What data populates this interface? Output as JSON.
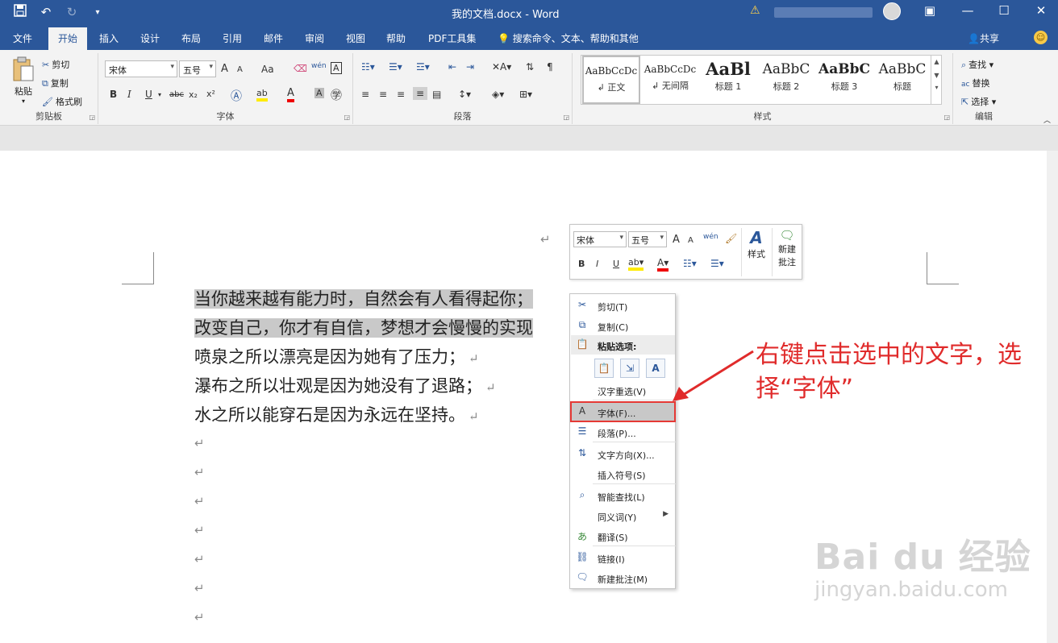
{
  "window": {
    "title": "我的文档.docx  -  Word"
  },
  "quick_access": {
    "save_icon": "save-icon",
    "undo_icon": "undo-icon",
    "redo_icon": "redo-icon",
    "customize_icon": "customize-icon"
  },
  "menu": {
    "tabs": [
      "文件",
      "开始",
      "插入",
      "设计",
      "布局",
      "引用",
      "邮件",
      "审阅",
      "视图",
      "帮助",
      "PDF工具集"
    ],
    "active": "开始",
    "search": "搜索命令、文本、帮助和其他",
    "share": "共享"
  },
  "ribbon": {
    "clipboard": {
      "label": "剪贴板",
      "paste": "粘贴",
      "cut": "剪切",
      "copy": "复制",
      "format_painter": "格式刷"
    },
    "font": {
      "label": "字体",
      "font_name": "宋体",
      "font_size": "五号",
      "bold": "B",
      "italic": "I",
      "underline": "U",
      "strike": "abc",
      "subscript": "x₂",
      "superscript": "x²",
      "grow": "A",
      "shrink": "A",
      "case": "Aa",
      "pinyin": "wén",
      "border_char": "A"
    },
    "paragraph": {
      "label": "段落"
    },
    "styles": {
      "label": "样式",
      "items": [
        {
          "sample": "AaBbCcDc",
          "name": "↲ 正文"
        },
        {
          "sample": "AaBbCcDc",
          "name": "↲ 无间隔"
        },
        {
          "sample": "AaBl",
          "name": "标题 1"
        },
        {
          "sample": "AaBbC",
          "name": "标题 2"
        },
        {
          "sample": "AaBbC",
          "name": "标题 3"
        },
        {
          "sample": "AaBbC",
          "name": "标题"
        }
      ]
    },
    "editing": {
      "label": "编辑",
      "find": "查找",
      "replace": "替换",
      "select": "选择"
    }
  },
  "document": {
    "lines": [
      "当你越来越有能力时，自然会有人看得起你；",
      "改变自己，你才有自信，梦想才会慢慢的实现",
      "喷泉之所以漂亮是因为她有了压力；",
      "瀑布之所以壮观是因为她没有了退路；",
      "水之所以能穿石是因为永远在坚持。"
    ],
    "para_mark": "↵"
  },
  "mini_toolbar": {
    "font_name": "宋体",
    "font_size": "五号",
    "styles": "样式",
    "new_comment_1": "新建",
    "new_comment_2": "批注"
  },
  "context_menu": {
    "cut": "剪切(T)",
    "copy": "复制(C)",
    "paste_options": "粘贴选项:",
    "reconvert": "汉字重选(V)",
    "font": "字体(F)...",
    "paragraph": "段落(P)...",
    "text_direction": "文字方向(X)...",
    "insert_symbol": "插入符号(S)",
    "smart_lookup": "智能查找(L)",
    "synonyms": "同义词(Y)",
    "translate": "翻译(S)",
    "link": "链接(I)",
    "new_comment": "新建批注(M)"
  },
  "annotation": {
    "text": "右键点击选中的文字，选择“字体”"
  },
  "watermark": {
    "logo": "Bai du 经验",
    "sub": "jingyan.baidu.com"
  },
  "colors": {
    "word_blue": "#2b579a",
    "annotation_red": "#e02b2b",
    "selection_gray": "#c9c9c9"
  }
}
